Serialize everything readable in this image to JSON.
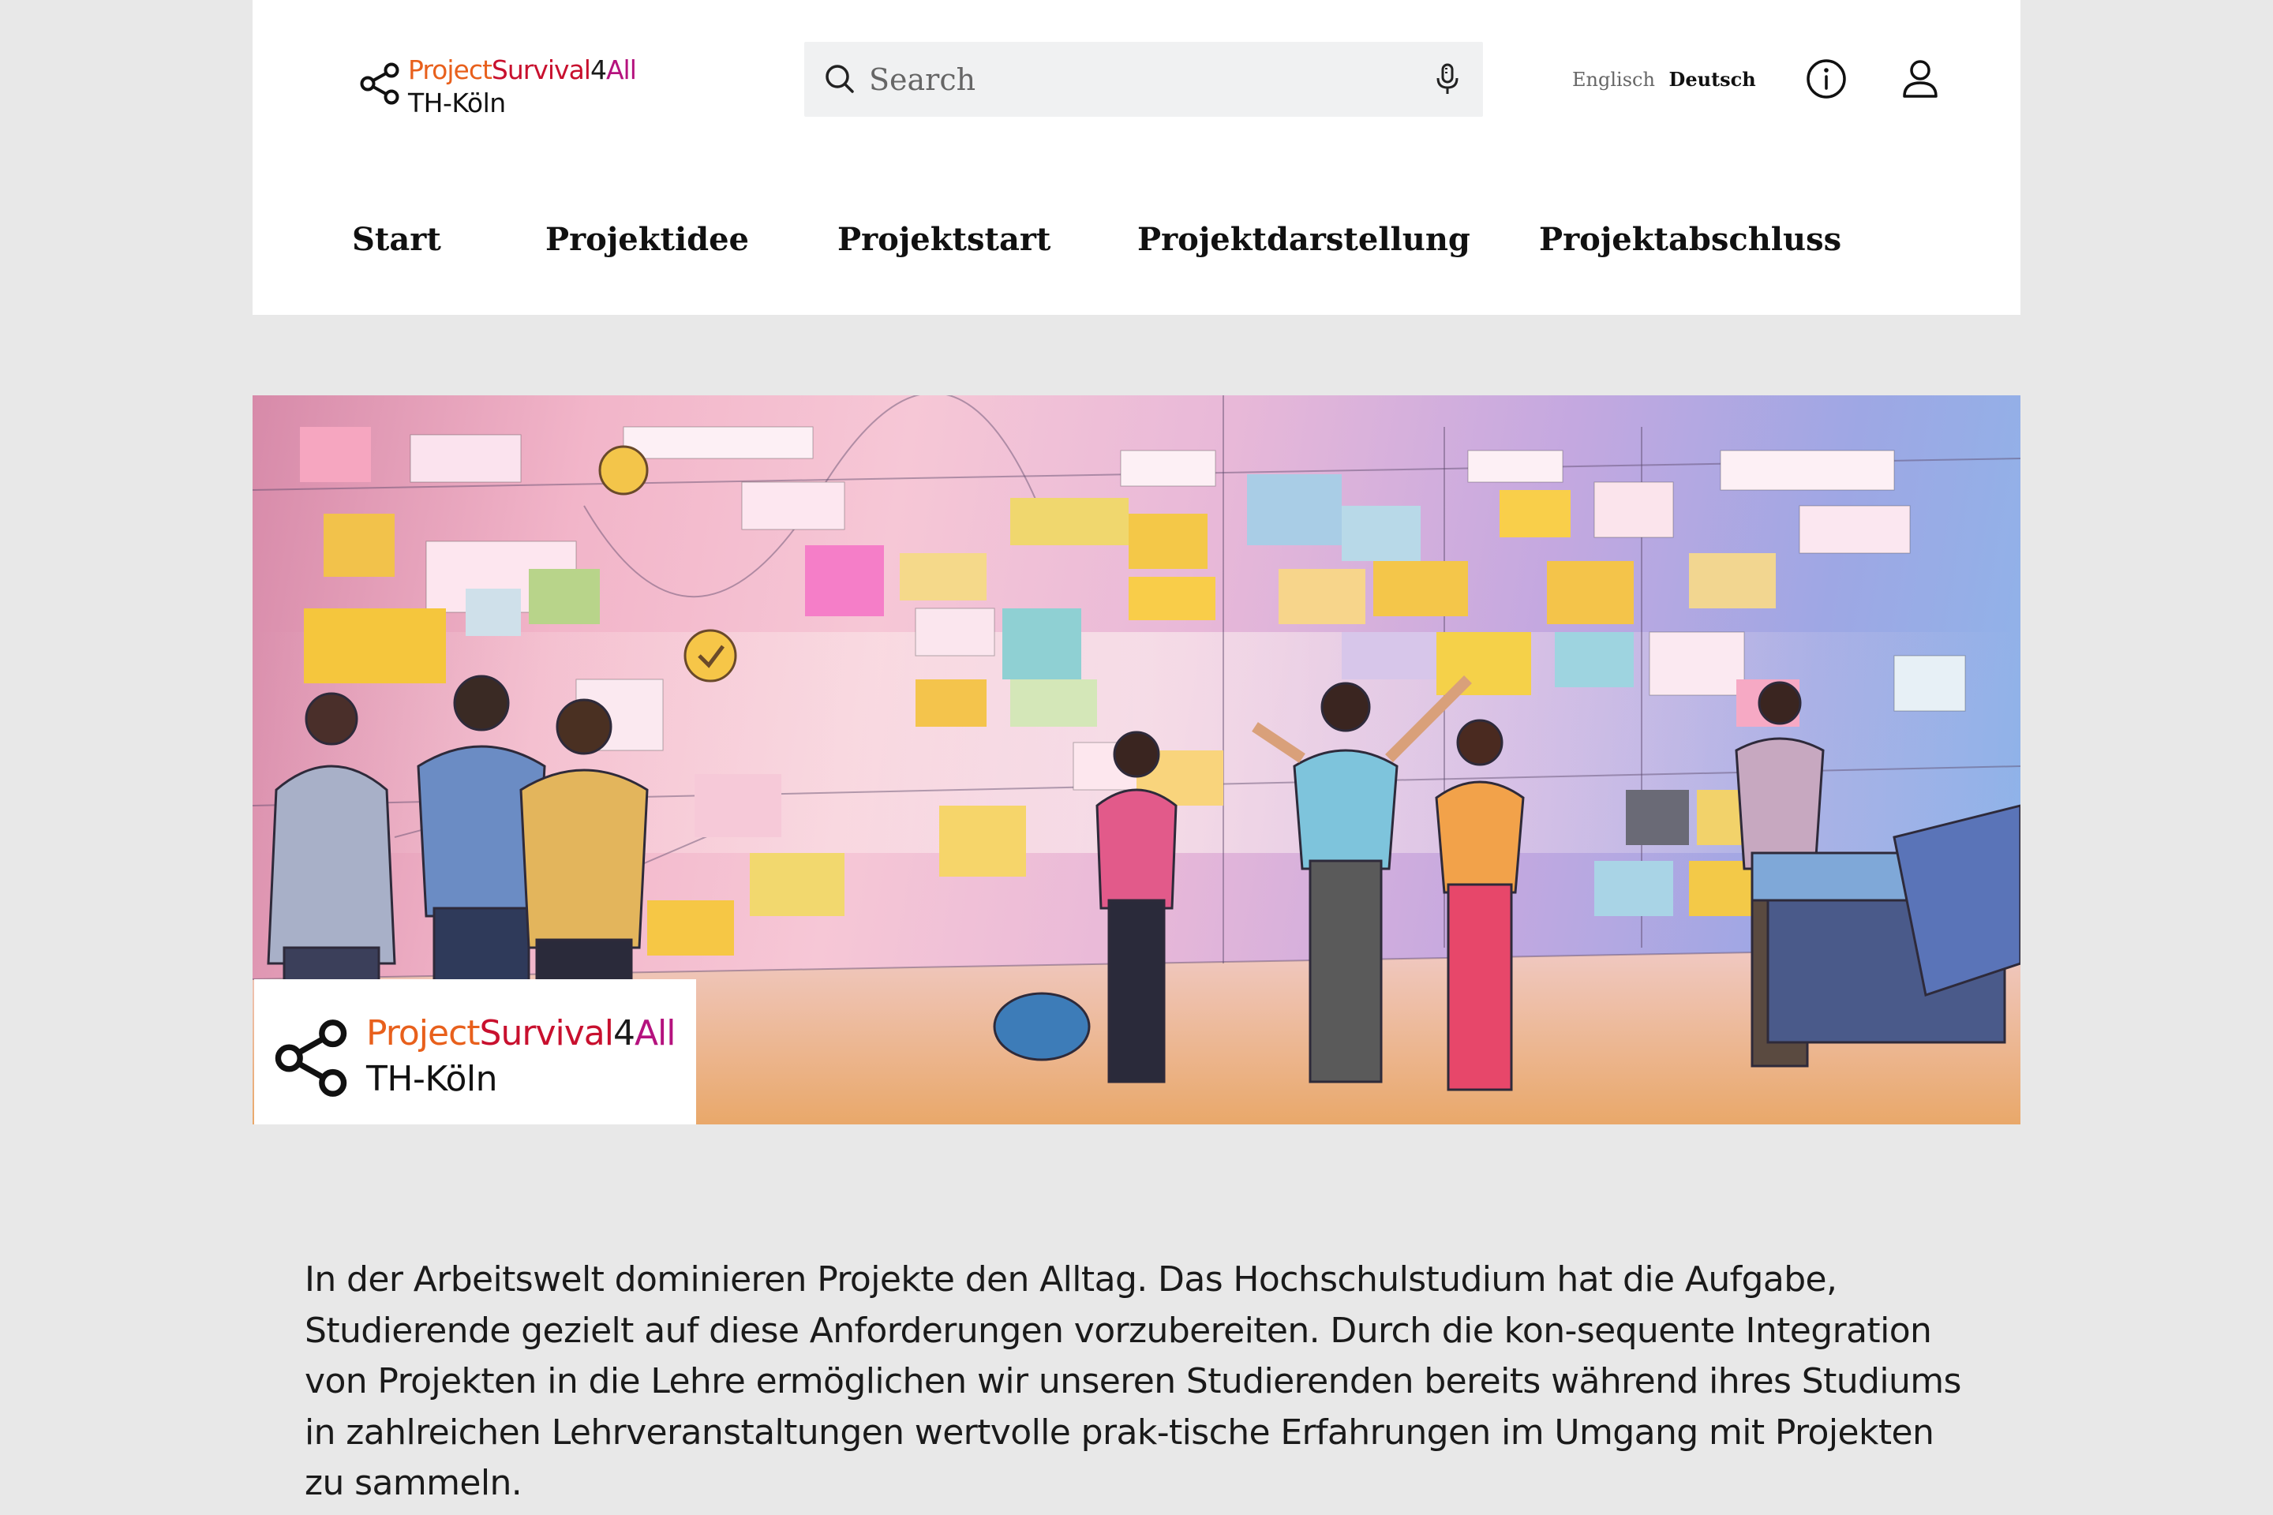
{
  "brand": {
    "name_part1": "Project",
    "name_part2": "Survival",
    "name_part3": "4",
    "name_part4": "All",
    "subtitle": "TH-Köln",
    "colors": {
      "orange": "#e8601c",
      "red": "#c8102e",
      "dark": "#1a1a1a",
      "magenta": "#b5127e"
    },
    "icon": "share-icon"
  },
  "search": {
    "placeholder": "Search",
    "icon": "search-icon",
    "mic_icon": "microphone-icon"
  },
  "language": {
    "english": "Englisch",
    "german": "Deutsch",
    "active": "Deutsch"
  },
  "header_icons": {
    "info": "info-icon",
    "user": "user-icon"
  },
  "nav": {
    "items": [
      {
        "label": "Start"
      },
      {
        "label": "Projektidee"
      },
      {
        "label": "Projektstart"
      },
      {
        "label": "Projektdarstellung"
      },
      {
        "label": "Projektabschluss"
      }
    ]
  },
  "hero": {
    "badge": {
      "name_part1": "Project",
      "name_part2": "Survival",
      "name_part3": "4",
      "name_part4": "All",
      "subtitle": "TH-Köln"
    }
  },
  "intro": {
    "text": "In der Arbeitswelt dominieren Projekte den Alltag. Das Hochschulstudium hat die Aufgabe, Studierende gezielt auf diese Anforderungen vorzubereiten. Durch die kon-sequente Integration von Projekten in die Lehre ermöglichen wir unseren Studierenden bereits während ihres Studiums in zahlreichen Lehrveranstaltungen wertvolle prak-tische Erfahrungen im Umgang mit Projekten zu sammeln."
  }
}
